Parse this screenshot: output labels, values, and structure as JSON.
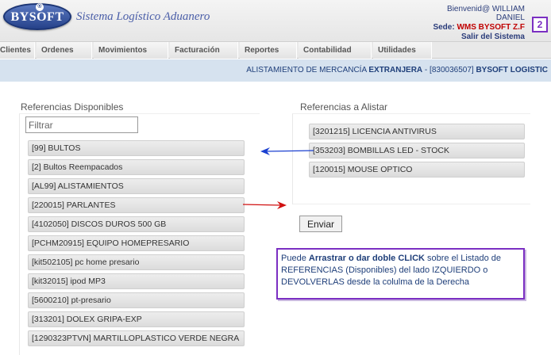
{
  "header": {
    "logo_text": "BYSOFT",
    "logo_reg": "®",
    "app_title": "Sistema Logístico Aduanero",
    "welcome_prefix": "Bienvenid@ WILLIAM",
    "user_name": "DANIEL",
    "sede_label": "Sede:",
    "sede_value": "WMS BYSOFT Z.F",
    "logout": "Salir del Sistema",
    "step_badge": "2"
  },
  "menu": [
    "Clientes",
    "Ordenes",
    "Movimientos",
    "Facturación",
    "Reportes",
    "Contabilidad",
    "Utilidades"
  ],
  "breadcrumb": {
    "prefix": "ALISTAMIENTO DE MERCANCÍA ",
    "bold1": "EXTRANJERA",
    "middle": " - [830036507] ",
    "bold2": "BYSOFT LOGISTIC"
  },
  "left_panel": {
    "title": "Referencias Disponibles",
    "filter_placeholder": "Filtrar",
    "items": [
      "[99] BULTOS",
      "[2] Bultos Reempacados",
      "[AL99] ALISTAMIENTOS",
      "[220015] PARLANTES",
      "[4102050] DISCOS DUROS 500 GB",
      "[PCHM20915] EQUIPO HOMEPRESARIO",
      "[kit502105] pc home presario",
      "[kit32015] ipod MP3",
      "[5600210] pt-presario",
      "[313201] DOLEX GRIPA-EXP",
      "[1290323PTVN] MARTILLOPLASTICO VERDE NEGRA"
    ]
  },
  "right_panel": {
    "title": "Referencias a Alistar",
    "items": [
      "[3201215] LICENCIA ANTIVIRUS",
      "[353203] BOMBILLAS LED - STOCK",
      "[120015] MOUSE OPTICO"
    ],
    "send_button": "Enviar"
  },
  "note": {
    "t1": "Puede ",
    "b1": "Arrastrar o dar doble CLICK",
    "t2": " sobre el Listado de REFERENCIAS (Disponibles)  del lado IZQUIERDO o DEVOLVERLAS desde la colulma de la Derecha"
  },
  "colors": {
    "arrow_blue": "#1a3fd0",
    "arrow_red": "#d01010",
    "note_border": "#7b2fc2",
    "sede_red": "#c00000"
  }
}
